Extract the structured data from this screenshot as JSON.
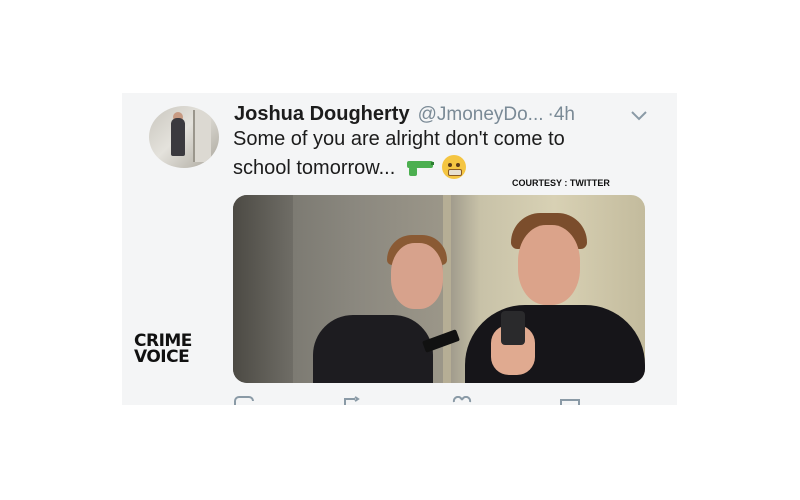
{
  "tweet": {
    "display_name": "Joshua Dougherty",
    "handle": "@JmoneyDo...",
    "separator": "·",
    "time": "4h",
    "text_line1": "Some of you are alright don't come to",
    "text_line2": "school tomorrow...",
    "emojis": [
      "water-pistol-icon",
      "grimacing-face-icon"
    ],
    "menu_icon": "chevron-down-icon",
    "photo_alt": "two young men taking a mirror selfie, one holding a gun"
  },
  "overlay": {
    "courtesy": "COURTESY : TWITTER",
    "watermark_line1": "CRIME",
    "watermark_line2": "VOICE"
  },
  "actions": [
    "reply-icon",
    "retweet-icon",
    "like-icon",
    "share-icon"
  ],
  "colors": {
    "card_bg": "#f4f5f6",
    "handle_gray": "#7a8a96",
    "gun_green": "#4caf50"
  }
}
